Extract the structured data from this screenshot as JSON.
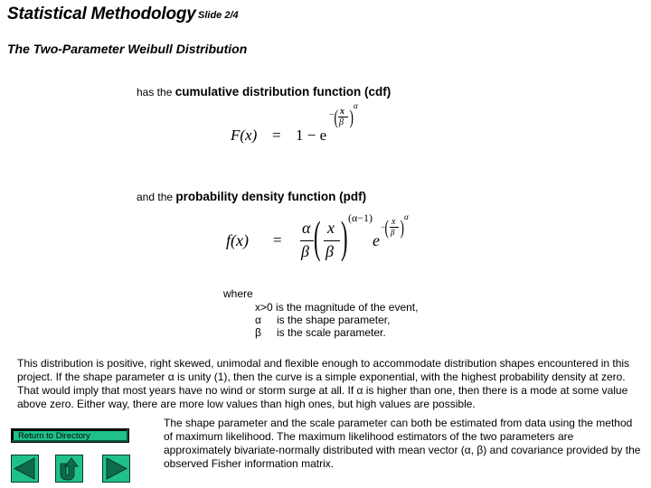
{
  "header": {
    "title": "Statistical Methodology",
    "slide": "Slide 2/4",
    "subtitle": "The Two-Parameter Weibull Distribution"
  },
  "cdf": {
    "prefix": "has the",
    "label": "cumulative distribution function (cdf)",
    "lhs": "F(x)",
    "eq": "=",
    "rhs_base": "1 − e",
    "exp_num": "x",
    "exp_den": "β",
    "exp_power": "α",
    "exp_sign": "−"
  },
  "pdf": {
    "prefix": "and the",
    "label": "probability density function (pdf)",
    "lhs": "f(x)",
    "eq": "=",
    "coef_num": "α",
    "coef_den": "β",
    "frac_num": "x",
    "frac_den": "β",
    "power": "(α−1)",
    "e": "e",
    "exp_sign": "−",
    "exp_num": "x",
    "exp_den": "β",
    "exp_power": "α"
  },
  "where": {
    "label": "where",
    "defs": [
      {
        "sym": "x>0",
        "text": "is the magnitude of the event,"
      },
      {
        "sym": "α",
        "text": "is the shape parameter,"
      },
      {
        "sym": "β",
        "text": "is the scale parameter."
      }
    ]
  },
  "paragraph1": "This distribution is positive, right skewed, unimodal and flexible enough to accommodate distribution shapes encountered in this project.  If the shape parameter α is unity (1), then the curve is a simple exponential, with the highest probability density at zero.  That would imply that most years have no wind or storm surge at all.  If α is higher than one, then there is a mode at some value above zero.  Either way, there are more low values than high ones, but high values are possible.",
  "paragraph2": "The shape parameter and the scale parameter can both be estimated from data using the method of maximum likelihood.  The maximum likelihood estimators of the two parameters are approximately bivariate-normally distributed with mean vector (α, β) and covariance provided by the observed Fisher information matrix.",
  "nav": {
    "return_label": "Return to Directory",
    "accent": "#20c08c",
    "icon_color": "#0d6b4c"
  }
}
